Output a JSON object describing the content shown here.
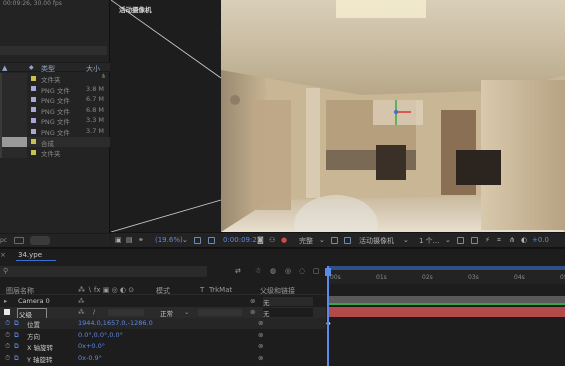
{
  "project": {
    "info": "00:09:26, 30.00 fps",
    "header": {
      "type": "类型",
      "size": "大小"
    },
    "items": [
      {
        "type": "文件夹",
        "size": "",
        "color": "#c7c24a"
      },
      {
        "type": "PNG 文件",
        "size": "3.8 M",
        "color": "#a7a8d8"
      },
      {
        "type": "PNG 文件",
        "size": "6.7 M",
        "color": "#a7a8d8"
      },
      {
        "type": "PNG 文件",
        "size": "6.8 M",
        "color": "#a7a8d8"
      },
      {
        "type": "PNG 文件",
        "size": "3.3 M",
        "color": "#a7a8d8"
      },
      {
        "type": "PNG 文件",
        "size": "3.7 M",
        "color": "#a7a8d8"
      },
      {
        "type": "合成",
        "size": "",
        "color": "#c7c24a"
      },
      {
        "type": "文件夹",
        "size": "",
        "color": "#c7c24a"
      }
    ],
    "footer_text": "pc"
  },
  "viewer": {
    "camera_label": "活动摄像机",
    "toolbar": {
      "zoom": "(19.6%)",
      "timecode": "0:00:09:21",
      "resolution": "完整",
      "camera": "活动摄像机",
      "views": "1 个...",
      "exposure": "+0.0"
    }
  },
  "timeline": {
    "comp_tab": "34.ype",
    "ruler_ticks": [
      "00s",
      "01s",
      "02s",
      "03s",
      "04s",
      "05s"
    ],
    "columns": {
      "layer_name": "图层名称",
      "mode": "模式",
      "t": "T",
      "trkmat": "TrkMat",
      "parent": "父级和链接"
    },
    "layers": [
      {
        "name": "Camera 0",
        "parent": "无"
      },
      {
        "name": "父级",
        "mode": "正常",
        "parent": "无"
      }
    ],
    "props": [
      {
        "name": "位置",
        "value": "1944.0,1657.0,-1286.0"
      },
      {
        "name": "方向",
        "value": "0.0°,0.0°,0.0°"
      },
      {
        "name": "X 轴旋转",
        "value": "0x+0.0°"
      },
      {
        "name": "Y 轴旋转",
        "value": "0x-0.9°"
      }
    ]
  },
  "colors": {
    "accent": "#3b6fd3",
    "camera_track": "#6a6a6a",
    "layer_track": "#b34a4a",
    "green_track": "#3aa54a"
  }
}
